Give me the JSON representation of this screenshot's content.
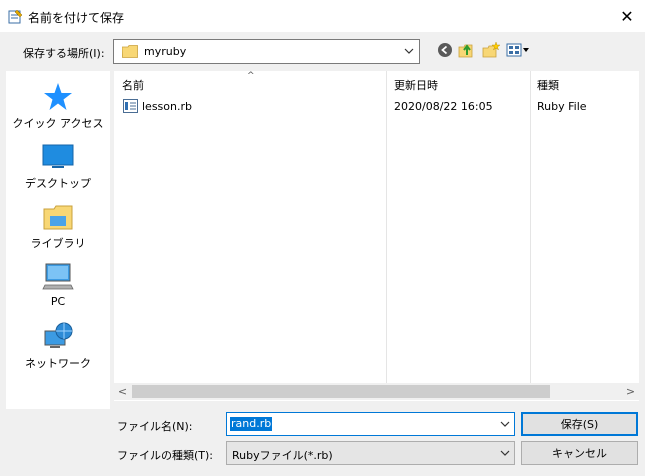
{
  "window": {
    "title": "名前を付けて保存",
    "close_glyph": "✕"
  },
  "location": {
    "label": "保存する場所(I):",
    "value": "myruby"
  },
  "toolbar": {
    "back_icon": "back-arrow-icon",
    "up_icon": "up-folder-icon",
    "new_folder_icon": "new-folder-icon",
    "view_icon": "view-menu-icon"
  },
  "places": [
    {
      "label": "クイック アクセス",
      "icon": "quick-access-star-icon"
    },
    {
      "label": "デスクトップ",
      "icon": "desktop-icon"
    },
    {
      "label": "ライブラリ",
      "icon": "library-icon"
    },
    {
      "label": "PC",
      "icon": "pc-icon"
    },
    {
      "label": "ネットワーク",
      "icon": "network-icon"
    }
  ],
  "columns": {
    "name": "名前",
    "modified": "更新日時",
    "type": "種類",
    "sort_glyph": "^"
  },
  "files": [
    {
      "name": "lesson.rb",
      "modified": "2020/08/22 16:05",
      "type": "Ruby File"
    }
  ],
  "scroll": {
    "left": "<",
    "right": ">"
  },
  "filename": {
    "label": "ファイル名(N):",
    "value": "rand.rb"
  },
  "filetype": {
    "label": "ファイルの種類(T):",
    "value": "Rubyファイル(*.rb)"
  },
  "buttons": {
    "save": "保存(S)",
    "cancel": "キャンセル"
  },
  "colors": {
    "accent": "#0078d7",
    "folder": "#f8d775",
    "star": "#1e90ff"
  }
}
